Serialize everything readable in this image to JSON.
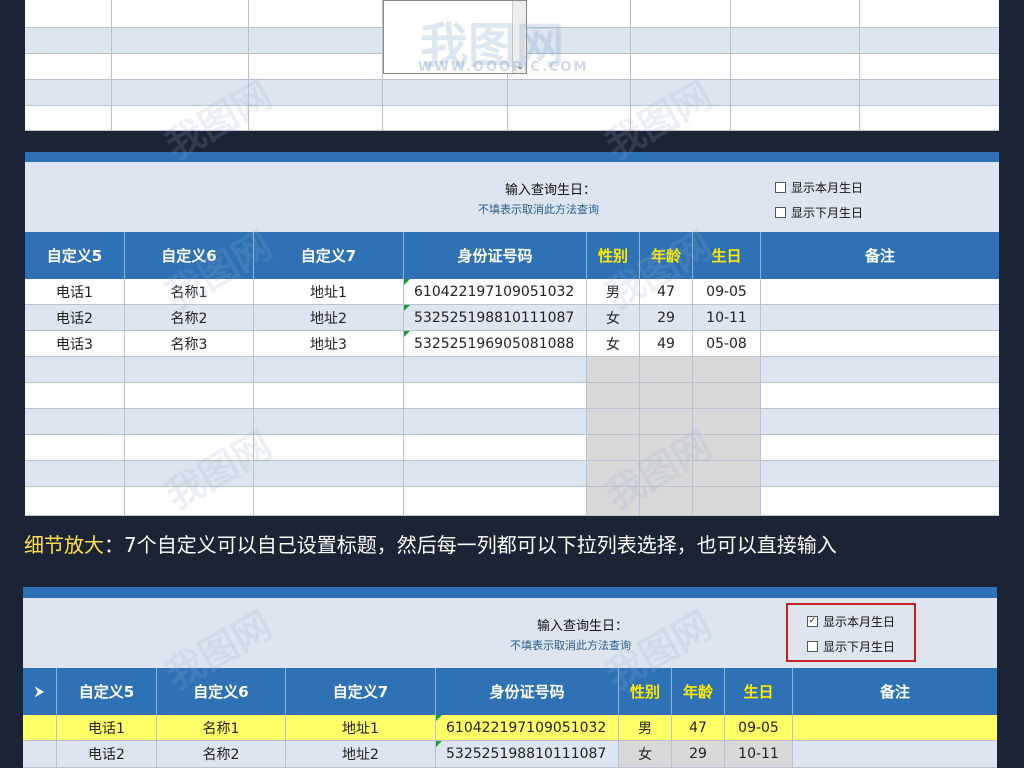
{
  "watermark": {
    "logo": "我图网",
    "url": "WWW.OOOPIC.COM"
  },
  "panel1": {
    "dropdown_text": "..."
  },
  "panel2": {
    "query_label": "输入查询生日：",
    "query_hint": "不填表示取消此方法查询",
    "checkbox_this_month": {
      "label": "显示本月生日",
      "checked": false
    },
    "checkbox_next_month": {
      "label": "显示下月生日",
      "checked": false
    },
    "columns": [
      "自定义5",
      "自定义6",
      "自定义7",
      "身份证号码",
      "性别",
      "年龄",
      "生日",
      "备注"
    ],
    "rows": [
      {
        "c5": "电话1",
        "c6": "名称1",
        "c7": "地址1",
        "id": "610422197109051032",
        "gender": "男",
        "age": "47",
        "birthday": "09-05",
        "note": ""
      },
      {
        "c5": "电话2",
        "c6": "名称2",
        "c7": "地址2",
        "id": "532525198810111087",
        "gender": "女",
        "age": "29",
        "birthday": "10-11",
        "note": ""
      },
      {
        "c5": "电话3",
        "c6": "名称3",
        "c7": "地址3",
        "id": "532525196905081088",
        "gender": "女",
        "age": "49",
        "birthday": "05-08",
        "note": ""
      }
    ]
  },
  "caption": {
    "prefix": "细节放大",
    "text": "：7个自定义可以自己设置标题，然后每一列都可以下拉列表选择，也可以直接输入"
  },
  "panel3": {
    "query_label": "输入查询生日：",
    "query_hint": "不填表示取消此方法查询",
    "checkbox_this_month": {
      "label": "显示本月生日",
      "checked": true,
      "mark": "✓"
    },
    "checkbox_next_month": {
      "label": "显示下月生日",
      "checked": false
    },
    "columns": [
      "自定义5",
      "自定义6",
      "自定义7",
      "身份证号码",
      "性别",
      "年龄",
      "生日",
      "备注"
    ],
    "rows": [
      {
        "c5": "电话1",
        "c6": "名称1",
        "c7": "地址1",
        "id": "610422197109051032",
        "gender": "男",
        "age": "47",
        "birthday": "09-05",
        "note": ""
      },
      {
        "c5": "电话2",
        "c6": "名称2",
        "c7": "地址2",
        "id": "532525198810111087",
        "gender": "女",
        "age": "29",
        "birthday": "10-11",
        "note": ""
      }
    ]
  },
  "colors": {
    "header_blue": "#2e72b5",
    "row_alt": "#dde6f0",
    "highlight_row": "#ffff66",
    "yellow_header_text": "#ffea00",
    "caption_accent": "#ffe14d",
    "red_box": "#c51f26"
  }
}
